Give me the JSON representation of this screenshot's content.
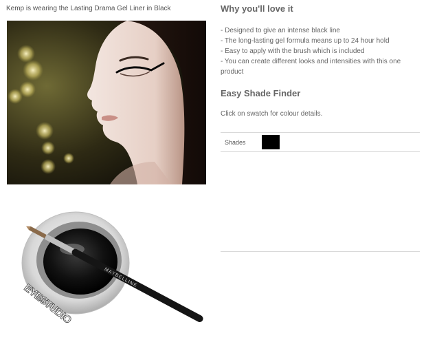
{
  "caption": "Kemp is wearing the Lasting Drama Gel Liner in Black",
  "why": {
    "title": "Why you'll love it",
    "bullets": [
      "- Designed to give an intense black line",
      "- The long-lasting gel formula means up to 24 hour hold",
      "- Easy to apply with the brush which is included",
      "- You can create different looks and intensities with this one product"
    ]
  },
  "shade_finder": {
    "title": "Easy Shade Finder",
    "instruction": "Click on swatch for colour details.",
    "shades_label": "Shades",
    "swatches": [
      {
        "name": "Black",
        "color": "#000000"
      }
    ]
  },
  "product": {
    "jar_text": "EYESTUDIO",
    "brush_text": "MAYBELLINE"
  },
  "colors": {
    "text": "#666666",
    "divider": "#d9d9d9"
  }
}
